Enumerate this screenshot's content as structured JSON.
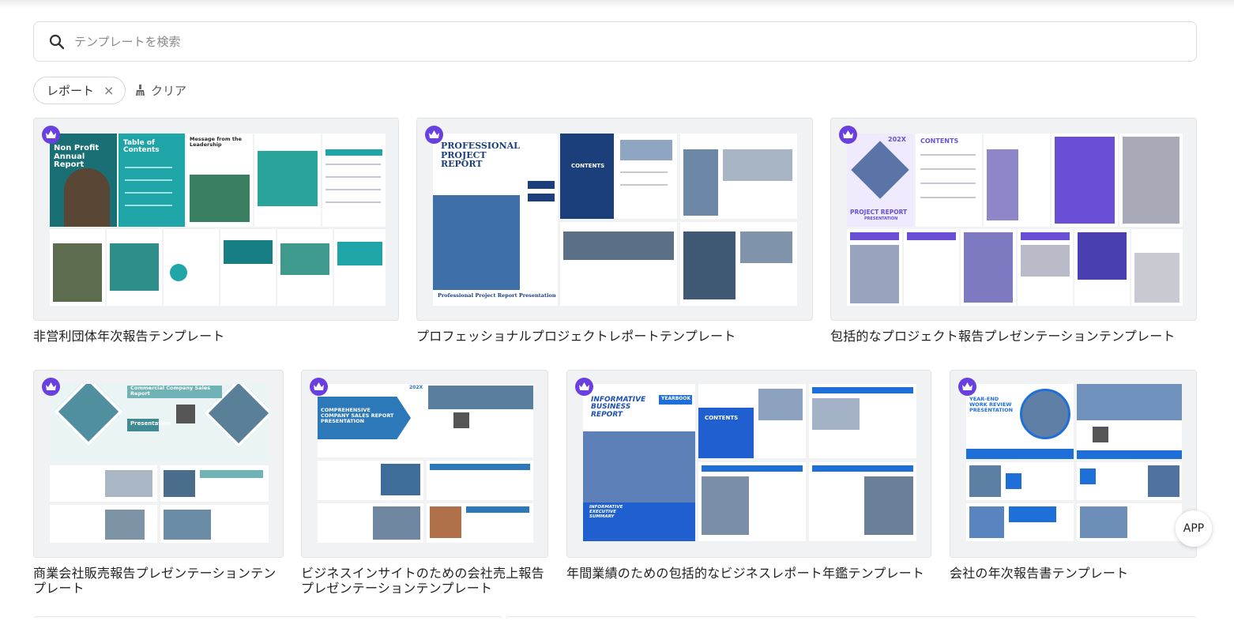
{
  "search": {
    "placeholder": "テンプレートを検索"
  },
  "filters": {
    "chip_label": "レポート",
    "chip_remove": "×",
    "clear_label": "クリア"
  },
  "cards": [
    {
      "title": "非営利団体年次報告テンプレート",
      "cover": "Non Profit Annual Report",
      "toc": "Table of Contents",
      "section": "Message from the Leadership",
      "premium": true
    },
    {
      "title": "プロフェッショナルプロジェクトレポートテンプレート",
      "cover": "PROFESSIONAL PROJECT REPORT",
      "footer": "Professional Project Report Presentation",
      "section": "CONTENTS",
      "premium": true
    },
    {
      "title": "包括的なプロジェクト報告プレゼンテーションテンプレート",
      "cover": "PROJECT REPORT",
      "cover_sub": "PRESENTATION",
      "year": "202X",
      "section": "CONTENTS",
      "premium": true
    },
    {
      "title": "商業会社販売報告プレゼンテーションテンプレート",
      "cover": "Commercial Company Sales Report",
      "cover_sub": "Presentation",
      "premium": true
    },
    {
      "title": "ビジネスインサイトのための会社売上報告プレゼンテーションテンプレート",
      "cover": "COMPREHENSIVE COMPANY SALES REPORT PRESENTATION",
      "year": "202X",
      "premium": true
    },
    {
      "title": "年間業績のための包括的なビジネスレポート年鑑テンプレート",
      "cover": "INFORMATIVE BUSINESS REPORT",
      "cover_tag": "YEARBOOK",
      "cover_sub": "INFORMATIVE EXECUTIVE SUMMARY",
      "section": "CONTENTS",
      "premium": true
    },
    {
      "title": "会社の年次報告書テンプレート",
      "cover": "YEAR-END WORK REVIEW PRESENTATION",
      "premium": true
    }
  ],
  "app_button": "APP",
  "colors": {
    "premium": "#6a3fe0",
    "teal": "#1fa5a8",
    "navy": "#1b3f7a",
    "violet": "#6a4fd6",
    "blue": "#1f6fd8"
  }
}
